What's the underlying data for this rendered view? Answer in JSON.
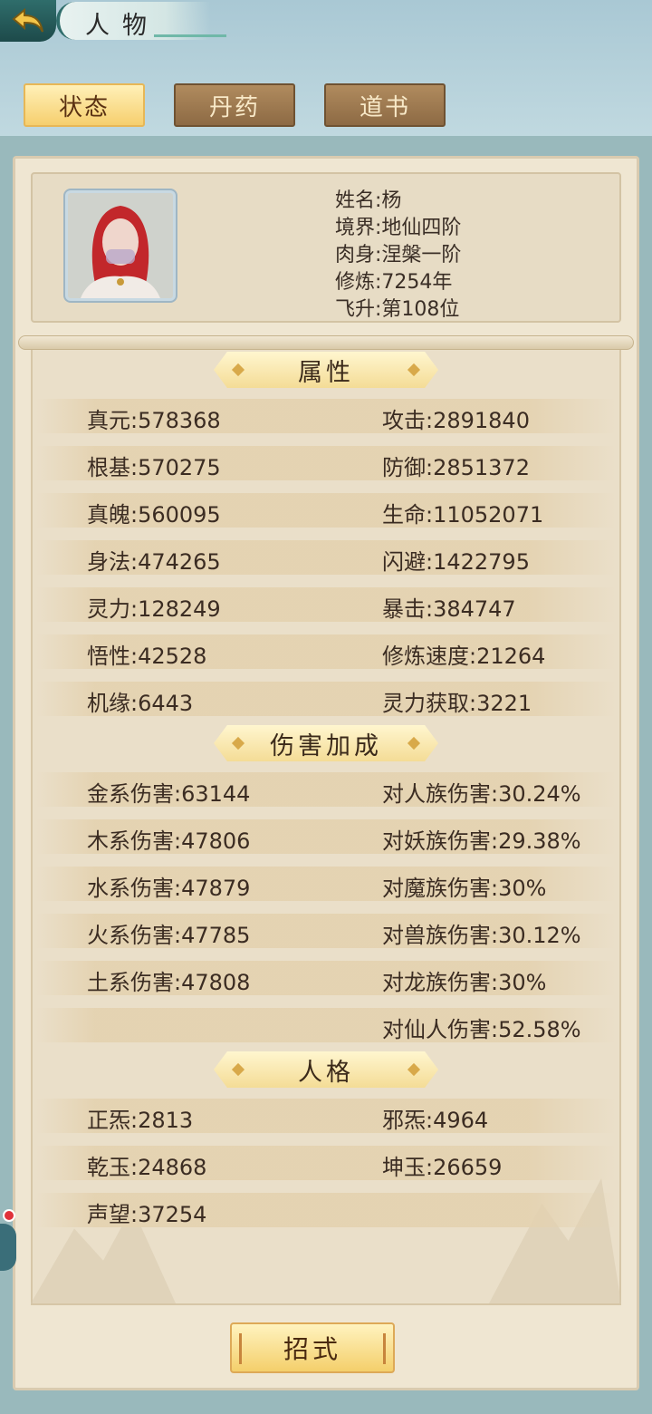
{
  "header": {
    "title": "人物"
  },
  "tabs": [
    {
      "label": "状态",
      "active": true
    },
    {
      "label": "丹药",
      "active": false
    },
    {
      "label": "道书",
      "active": false
    }
  ],
  "profile": {
    "name": "姓名:杨",
    "realm": "境界:地仙四阶",
    "body": "肉身:涅槃一阶",
    "cultivation": "修炼:7254年",
    "ascension": "飞升:第108位"
  },
  "sections": {
    "attributes": "属性",
    "damage_bonus": "伤害加成",
    "personality": "人格"
  },
  "attributes": {
    "left": [
      "真元:578368",
      "根基:570275",
      "真魄:560095",
      "身法:474265",
      "灵力:128249",
      "悟性:42528",
      "机缘:6443"
    ],
    "right": [
      "攻击:2891840",
      "防御:2851372",
      "生命:11052071",
      "闪避:1422795",
      "暴击:384747",
      "修炼速度:21264",
      "灵力获取:3221"
    ]
  },
  "damage": {
    "left": [
      "金系伤害:63144",
      "木系伤害:47806",
      "水系伤害:47879",
      "火系伤害:47785",
      "土系伤害:47808"
    ],
    "right": [
      "对人族伤害:30.24%",
      "对妖族伤害:29.38%",
      "对魔族伤害:30%",
      "对兽族伤害:30.12%",
      "对龙族伤害:30%",
      "对仙人伤害:52.58%"
    ]
  },
  "personality": {
    "left": [
      "正炁:2813",
      "乾玉:24868",
      "声望:37254"
    ],
    "right": [
      "邪炁:4964",
      "坤玉:26659"
    ]
  },
  "footer": {
    "skill_button": "招式"
  },
  "colors": {
    "tab_active": "#f6cf6e",
    "tab_inactive": "#8d6a44",
    "panel": "#efe6d2",
    "accent_dot": "#e0323a"
  }
}
